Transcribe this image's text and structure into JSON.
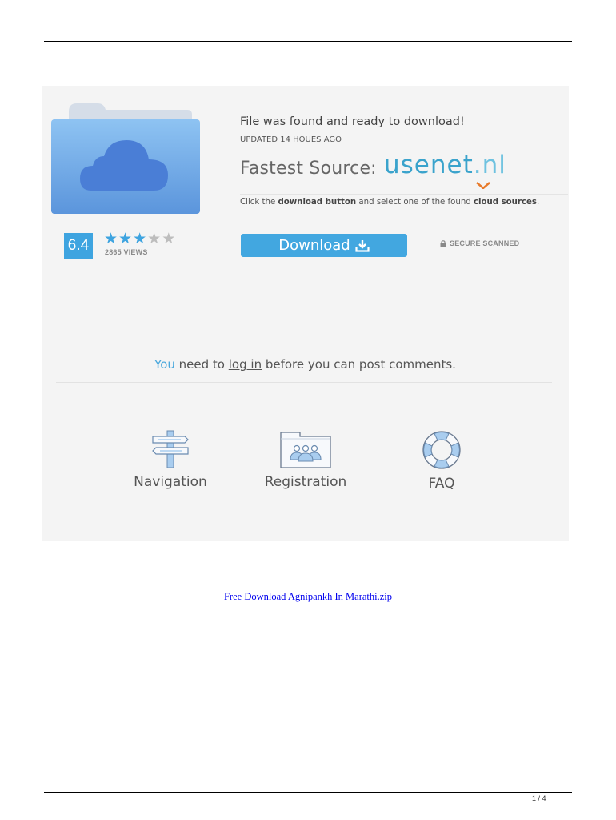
{
  "file_card": {
    "title": "File was found and ready to download!",
    "updated": "UPDATED 14 HOUES AGO",
    "fastest_source_label": "Fastest Source:",
    "source_brand": "usenet",
    "source_brand_tld": ".nl",
    "instruction_pre": "Click the ",
    "instruction_bold1": "download button",
    "instruction_mid": " and select one of the found ",
    "instruction_bold2": "cloud sources",
    "instruction_post": ".",
    "download_label": "Download",
    "secure_label": "SECURE SCANNED",
    "rating": "6.4",
    "stars_filled": 3,
    "stars_total": 5,
    "views": "2865 VIEWS",
    "folder_icon": "cloud-folder-icon",
    "colors": {
      "accent": "#42a7e0",
      "brand": "#3aa3cc",
      "chevron": "#e87a2a"
    }
  },
  "comments": {
    "you": "You",
    "need_to": " need to ",
    "login_link": "log in",
    "rest": " before you can post comments."
  },
  "features": [
    {
      "label": "Navigation",
      "icon": "signpost-icon"
    },
    {
      "label": "Registration",
      "icon": "users-folder-icon"
    },
    {
      "label": "FAQ",
      "icon": "lifebuoy-icon"
    }
  ],
  "document": {
    "link_text": "Free Download Agnipankh In Marathi.zip",
    "page_number": "1 / 4"
  }
}
